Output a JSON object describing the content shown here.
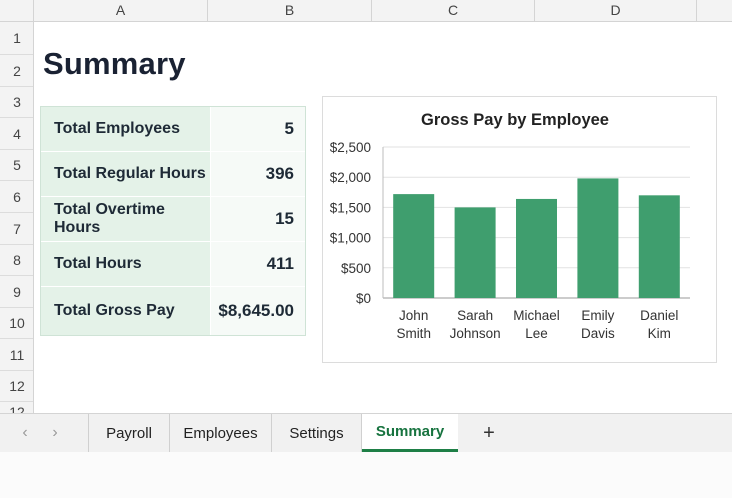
{
  "spreadsheet": {
    "columns": [
      "A",
      "B",
      "C",
      "D"
    ],
    "rows": [
      "1",
      "2",
      "3",
      "4",
      "5",
      "6",
      "7",
      "8",
      "9",
      "10",
      "11",
      "12",
      "12"
    ]
  },
  "sheet_title": "Summary",
  "summary": {
    "rows": [
      {
        "label": "Total Employees",
        "value": "5"
      },
      {
        "label": "Total Regular Hours",
        "value": "396"
      },
      {
        "label": "Total Overtime Hours",
        "value": "15"
      },
      {
        "label": "Total Hours",
        "value": "411"
      },
      {
        "label": "Total Gross Pay",
        "value": "$8,645.00"
      }
    ]
  },
  "chart_data": {
    "type": "bar",
    "title": "Gross Pay by Employee",
    "categories": [
      [
        "John",
        "Smith"
      ],
      [
        "Sarah",
        "Johnson"
      ],
      [
        "Michael",
        "Lee"
      ],
      [
        "Emily",
        "Davis"
      ],
      [
        "Daniel",
        "Kim"
      ]
    ],
    "values": [
      1720,
      1500,
      1640,
      1980,
      1700
    ],
    "ylim": [
      0,
      2500
    ],
    "yticks": [
      "$0",
      "$500",
      "$1,000",
      "$1,500",
      "$2,000",
      "$2,500"
    ],
    "bar_color": "#3f9e6e",
    "grid": true
  },
  "tabs": {
    "nav_prev": "‹",
    "nav_next": "›",
    "items": [
      "Payroll",
      "Employees",
      "Settings",
      "Summary"
    ],
    "active": "Summary",
    "add": "+"
  },
  "colors": {
    "accent": "#1e7f46",
    "label_fill": "#e4f2e8",
    "value_fill": "#f6faf7"
  }
}
